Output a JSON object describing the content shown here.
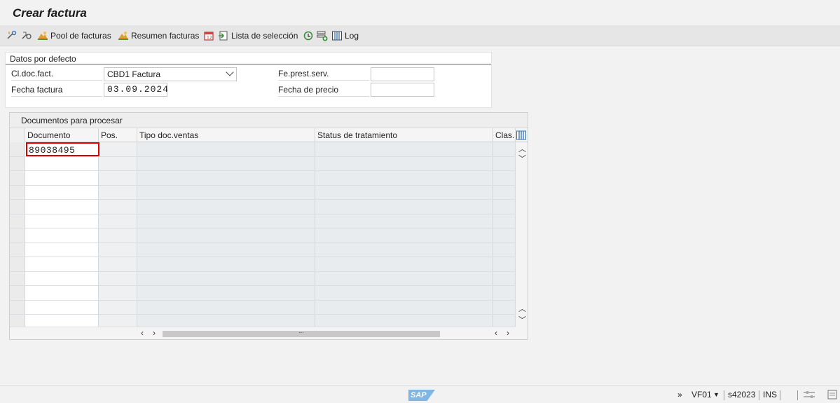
{
  "window": {
    "title": "Crear factura"
  },
  "toolbar": {
    "items": [
      {
        "label": "",
        "icon": "execute-icon"
      },
      {
        "label": "",
        "icon": "background-process-icon"
      },
      {
        "label": "Pool de facturas",
        "icon": "pool-icon"
      },
      {
        "label": "Resumen facturas",
        "icon": "summary-icon"
      },
      {
        "label": "",
        "icon": "calendar-icon"
      },
      {
        "label": "Lista de selección",
        "icon": "selection-list-icon"
      },
      {
        "label": "",
        "icon": "refresh-icon"
      },
      {
        "label": "",
        "icon": "add-row-icon"
      },
      {
        "label": "Log",
        "icon": "log-icon"
      }
    ]
  },
  "defaults_panel": {
    "title": "Datos por defecto",
    "billing_type_label": "Cl.doc.fact.",
    "billing_type_value": "CBD1 Factura",
    "invoice_date_label": "Fecha factura",
    "invoice_date_value": "03.09.2024",
    "service_date_label": "Fe.prest.serv.",
    "service_date_value": "",
    "price_date_label": "Fecha de precio",
    "price_date_value": ""
  },
  "documents_grid": {
    "title": "Documentos para procesar",
    "columns": [
      "Documento",
      "Pos.",
      "Tipo doc.ventas",
      "Status de tratamiento",
      "Clas..."
    ],
    "rows": [
      {
        "documento": "89038495",
        "pos": "",
        "tipo": "",
        "status": "",
        "clas": ""
      }
    ]
  },
  "statusbar": {
    "logo": "SAP",
    "transaction": "VF01",
    "server": "s42023",
    "mode": "INS"
  },
  "colors": {
    "highlight_border": "#e00000",
    "panel_line": "#3a6fa8",
    "sap_logo": "#7fb6e3"
  }
}
